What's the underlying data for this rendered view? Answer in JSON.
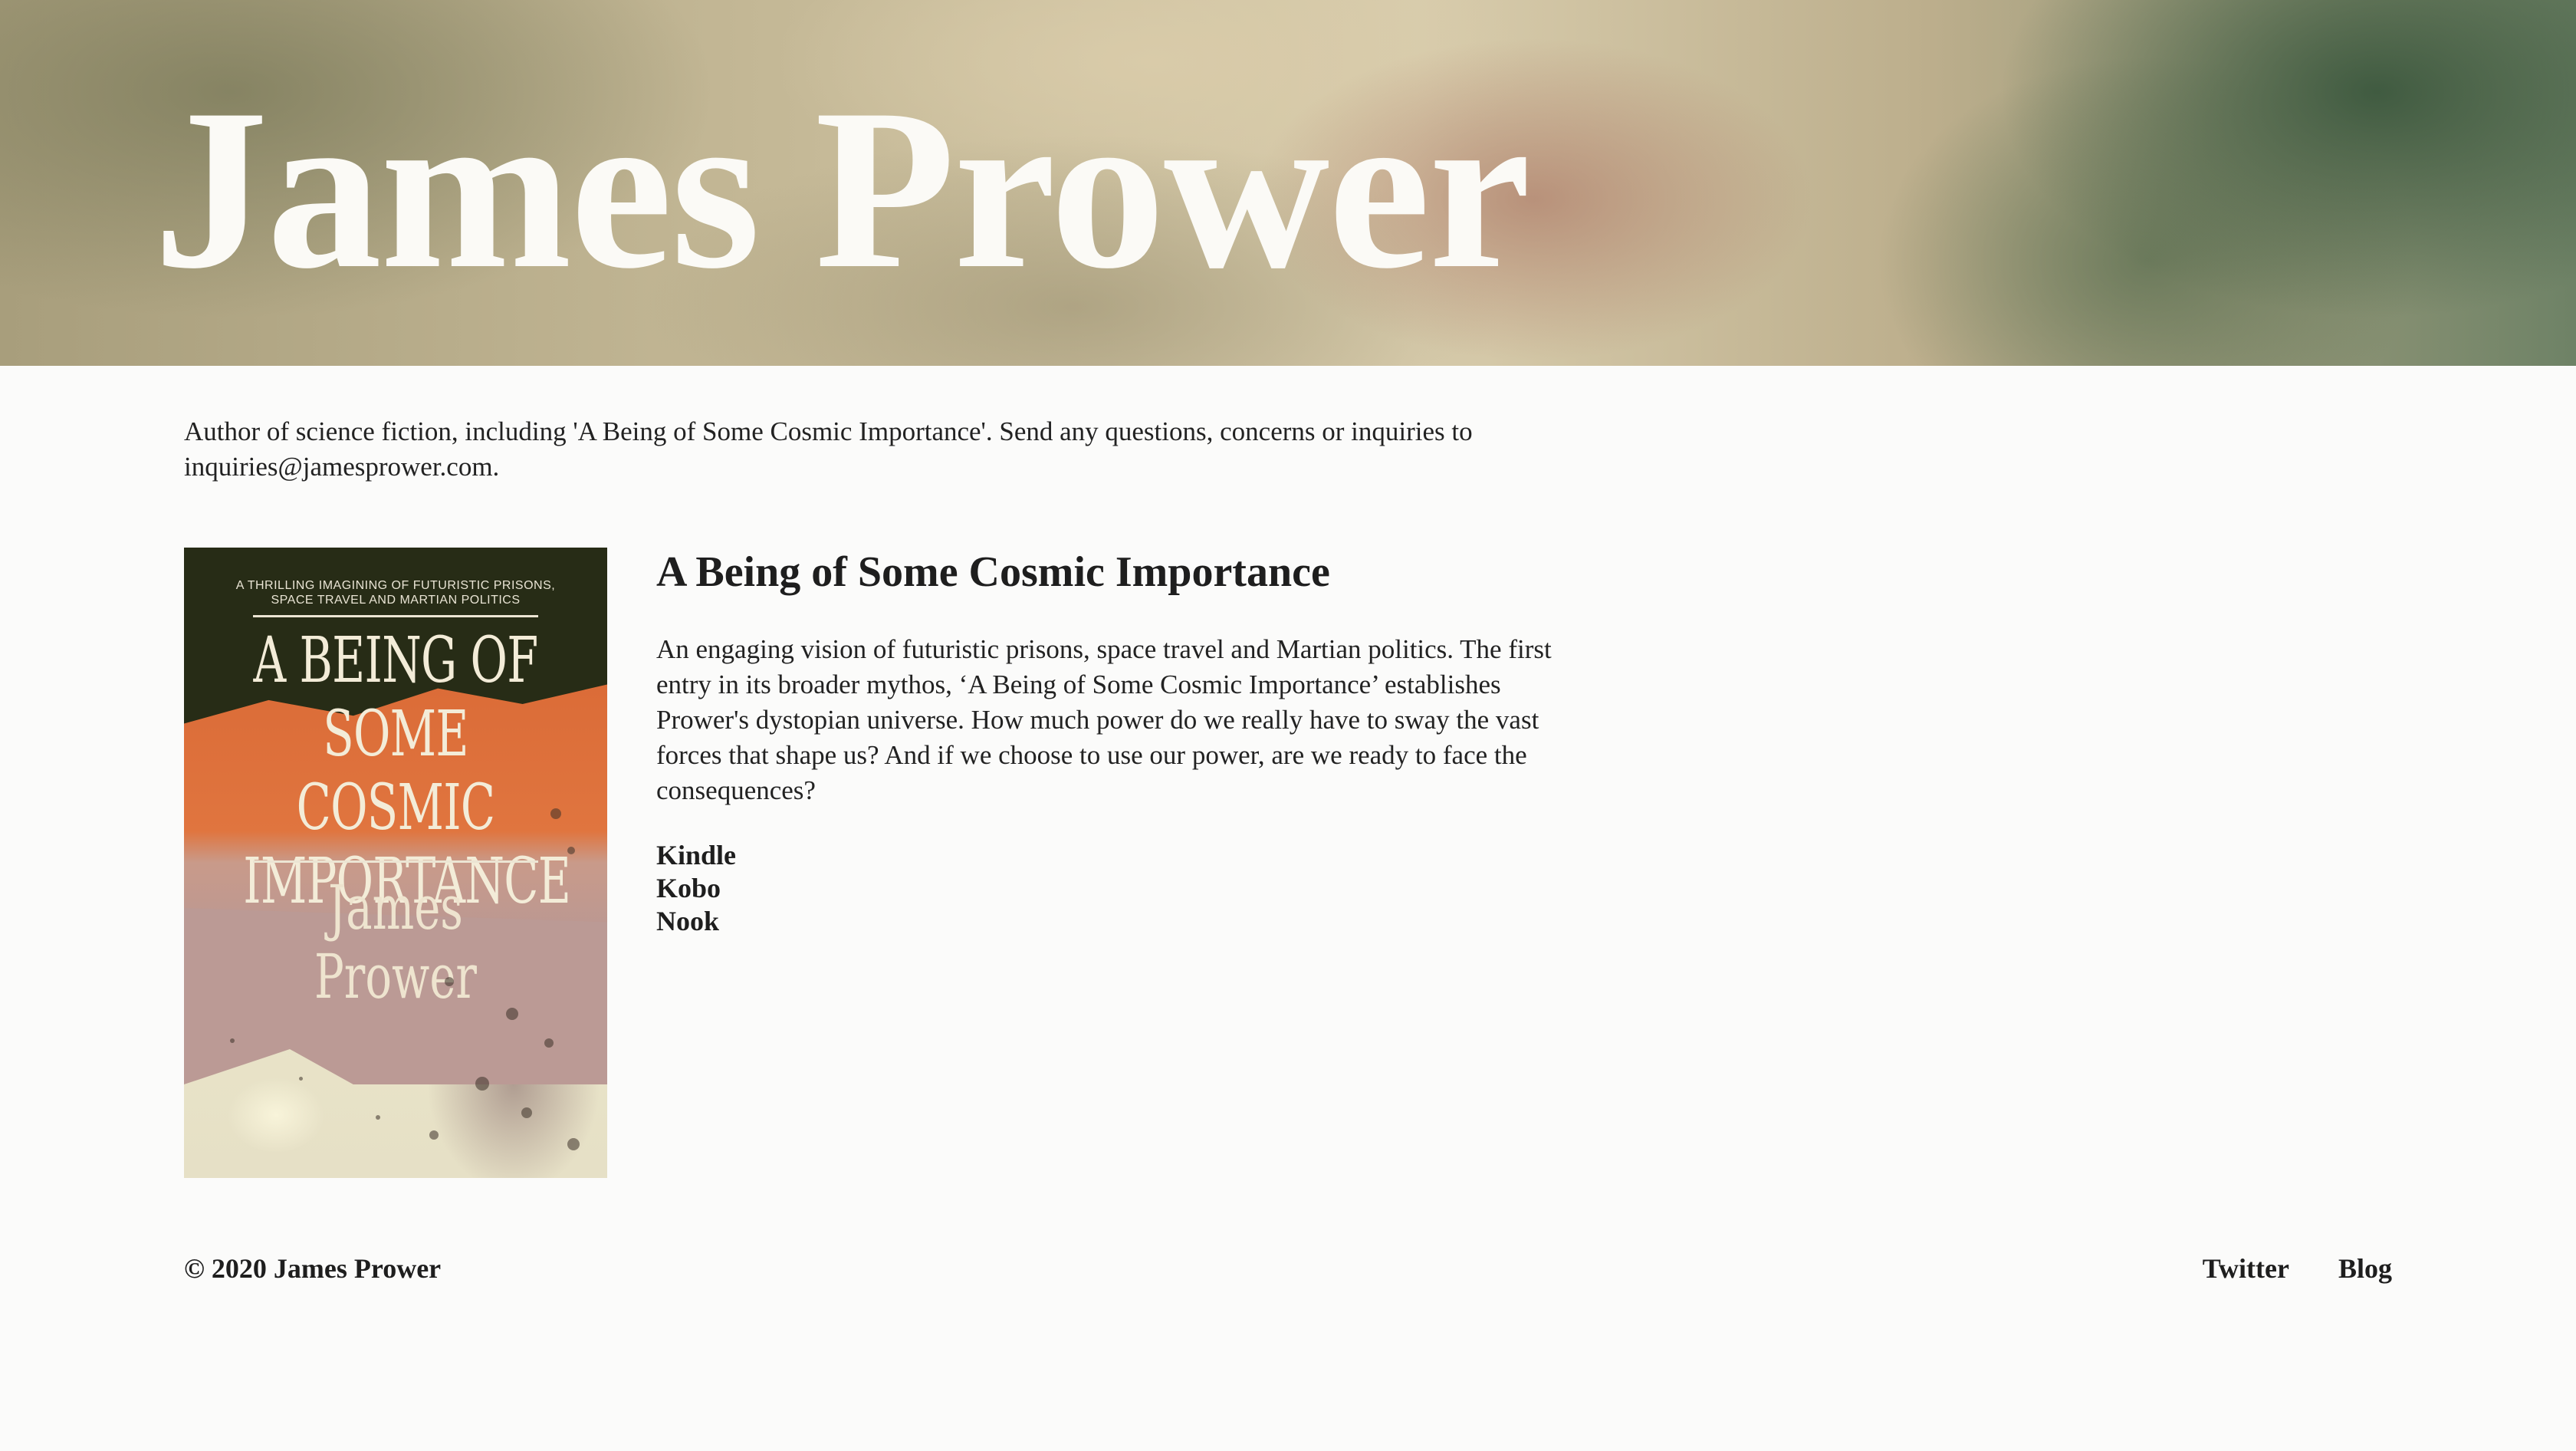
{
  "header": {
    "title": "James Prower"
  },
  "intro": {
    "text": "Author of science fiction, including 'A Being of Some Cosmic Importance'. Send any questions, concerns or inquiries to inquiries@jamesprower.com."
  },
  "book": {
    "cover": {
      "tagline_line1": "A THRILLING IMAGINING OF FUTURISTIC PRISONS,",
      "tagline_line2": "SPACE TRAVEL AND MARTIAN POLITICS",
      "title_line1": "A BEING OF",
      "title_line2": "SOME COSMIC",
      "title_line3": "IMPORTANCE",
      "author": "James Prower"
    },
    "title": "A Being of Some Cosmic Importance",
    "description": "An engaging vision of futuristic prisons, space travel and Martian politics. The first entry in its broader mythos, ‘A Being of Some Cosmic Importance’ establishes Prower's dystopian universe. How much power do we really have to sway the vast forces that shape us? And if we choose to use our power, are we ready to face the consequences?",
    "stores": [
      "Kindle",
      "Kobo",
      "Nook"
    ]
  },
  "footer": {
    "copyright": "© 2020 James Prower",
    "links": [
      "Twitter",
      "Blog"
    ]
  },
  "colors": {
    "background": "#fbfbfa",
    "text": "#1e1e1e",
    "hero_title": "#fbfaf6",
    "cover_dark": "#272c16",
    "cover_orange": "#e0753f",
    "cover_mauve": "#bb9a95"
  }
}
